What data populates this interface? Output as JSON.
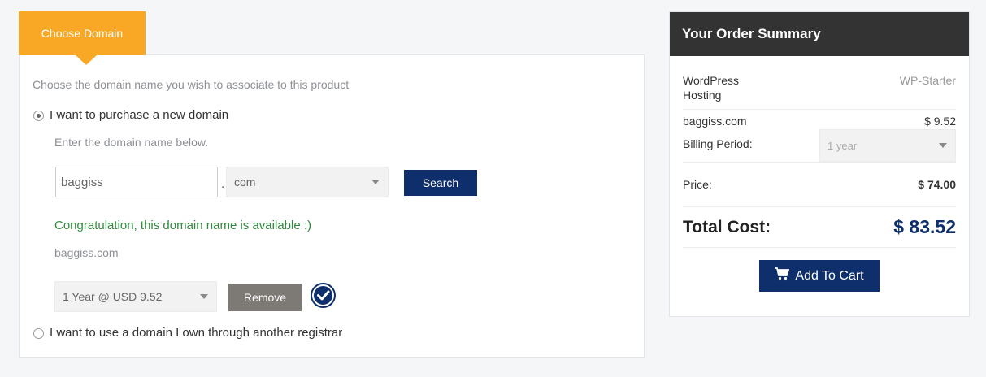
{
  "tab": {
    "label": "Choose Domain"
  },
  "intro": "Choose the domain name you wish to associate to this product",
  "options": {
    "purchase_label": "I want to purchase a new domain",
    "transfer_label": "I want to use a domain I own through another registrar"
  },
  "domain_hint": "Enter the domain name below.",
  "domain_input": {
    "value": "baggiss"
  },
  "dot": ".",
  "tld_select": {
    "value": "com"
  },
  "search_button": "Search",
  "availability_message": "Congratulation, this domain name is available :)",
  "found_domain": "baggiss.com",
  "period_select": {
    "value": "1 Year @ USD 9.52"
  },
  "remove_button": "Remove",
  "summary": {
    "title": "Your Order Summary",
    "product_name": "WordPress Hosting",
    "product_plan": "WP-Starter",
    "domain_name": "baggiss.com",
    "domain_price": "$ 9.52",
    "billing_label": "Billing Period:",
    "billing_value": "1 year",
    "price_label": "Price:",
    "price_value": "$ 74.00",
    "total_label": "Total Cost:",
    "total_value": "$ 83.52",
    "cart_button": "Add To Cart"
  },
  "colors": {
    "accent_orange": "#f9a825",
    "primary_navy": "#0e2f6b",
    "success_green": "#2e8b3d",
    "header_dark": "#333333"
  },
  "icons": [
    "checkmark-circle-icon",
    "shopping-cart-icon",
    "chevron-down-icon"
  ]
}
